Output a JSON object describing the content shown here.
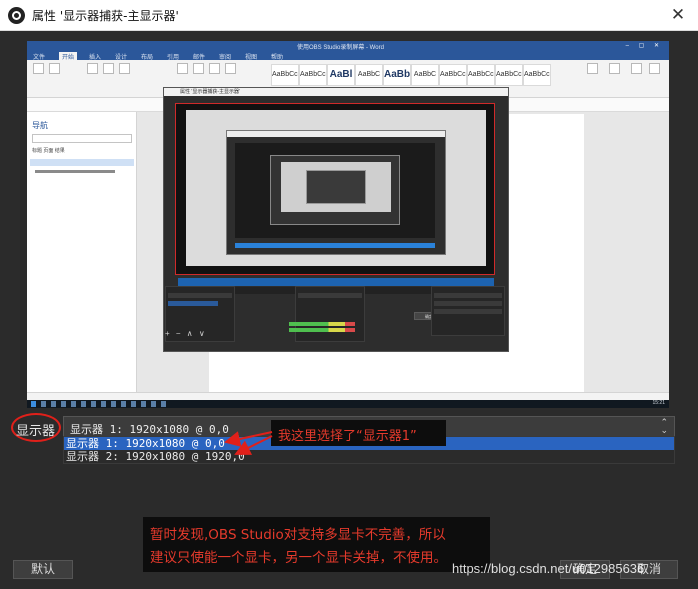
{
  "window": {
    "title": "属性 '显示器捕获-主显示器'",
    "close_glyph": "✕"
  },
  "preview": {
    "word_title": "使用OBS Studio录制屏幕 - Word",
    "word_tabs": [
      "文件",
      "开始",
      "插入",
      "设计",
      "布局",
      "引用",
      "邮件",
      "审阅",
      "视图",
      "帮助"
    ],
    "word_styles": [
      "AaBbCcI",
      "AaBbCcI",
      "AaBl",
      "AaBbC",
      "AaBbC",
      "AaBbC",
      "AaBbCcI",
      "AaBbCcI",
      "AaBbCcI",
      "AaBbCcI"
    ],
    "nav_title": "导航",
    "nav_tabs": "标题   页面   结果",
    "obs_title": "属性 '显示器捕获-主显示器'",
    "obs_defaults": "默认",
    "obs_ok": "确定",
    "obs_cancel": "取消",
    "obs_ctrls": "+ − ∧ ∨",
    "taskbar_time": "15:21"
  },
  "display": {
    "label": "显示器",
    "current_value": "显示器 1: 1920x1080 @ 0,0",
    "arrow_up": "⌃",
    "arrow_down": "⌄",
    "options": [
      "显示器 1: 1920x1080 @ 0,0",
      "显示器 2: 1920x1080 @ 1920,0"
    ]
  },
  "annotations": {
    "callout": "我这里选择了“显示器1”",
    "note_line1": "暂时发现,OBS Studio对支持多显卡不完善，所以",
    "note_line2": "建议只使能一个显卡，另一个显卡关掉，不使用。"
  },
  "footer": {
    "defaults_label": "默认",
    "ok_label": "确定",
    "cancel_label": "取消",
    "watermark": "https://blog.csdn.net/u012985636"
  },
  "colors": {
    "accent_red": "#e0201a",
    "selection_blue": "#2a64c0",
    "dialog_bg": "#2b2b2b"
  }
}
